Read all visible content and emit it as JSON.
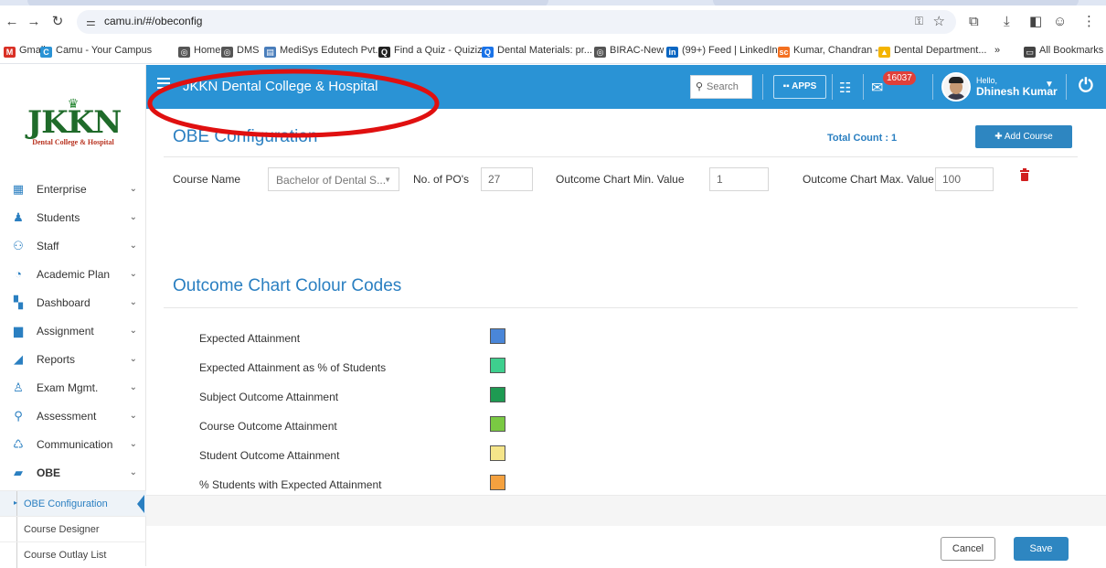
{
  "browser": {
    "url": "camu.in/#/obeconfig",
    "bookmarks": [
      {
        "label": "Gmail",
        "icon": "gmail-icon",
        "color": "#d93025"
      },
      {
        "label": "Camu - Your Campus",
        "icon": "camu-icon",
        "color": "#2a93d5"
      },
      {
        "label": "Home",
        "icon": "globe-icon",
        "color": "#555555"
      },
      {
        "label": "DMS",
        "icon": "globe-icon",
        "color": "#555555"
      },
      {
        "label": "MediSys Edutech Pvt...",
        "icon": "medisys-icon",
        "color": "#4a7ebb"
      },
      {
        "label": "Find a Quiz - Quizizz",
        "icon": "quizizz-icon",
        "color": "#222222"
      },
      {
        "label": "Dental Materials: pr...",
        "icon": "q-icon",
        "color": "#1a73e8"
      },
      {
        "label": "BIRAC-New",
        "icon": "globe-icon",
        "color": "#555555"
      },
      {
        "label": "(99+) Feed | LinkedIn",
        "icon": "linkedin-icon",
        "color": "#0a66c2"
      },
      {
        "label": "Kumar, Chandran -...",
        "icon": "sc-icon",
        "color": "#f37021"
      },
      {
        "label": "Dental Department...",
        "icon": "drive-icon",
        "color": "#f4b400"
      },
      {
        "label": "»",
        "icon": "",
        "color": ""
      },
      {
        "label": "All Bookmarks",
        "icon": "folder-icon",
        "color": "#444444"
      }
    ]
  },
  "sidebar": {
    "logo": {
      "name": "JKKN",
      "sub": "Dental College & Hospital"
    },
    "items": [
      {
        "label": "Enterprise",
        "icon": "building-icon",
        "color": "#2a7fc1"
      },
      {
        "label": "Students",
        "icon": "students-icon",
        "color": "#2a7fc1"
      },
      {
        "label": "Staff",
        "icon": "staff-icon",
        "color": "#2a7fc1"
      },
      {
        "label": "Academic Plan",
        "icon": "stopwatch-icon",
        "color": "#2a7fc1"
      },
      {
        "label": "Dashboard",
        "icon": "dashboard-icon",
        "color": "#2a7fc1"
      },
      {
        "label": "Assignment",
        "icon": "document-icon",
        "color": "#2a7fc1"
      },
      {
        "label": "Reports",
        "icon": "chart-icon",
        "color": "#2a7fc1"
      },
      {
        "label": "Exam Mgmt.",
        "icon": "exam-icon",
        "color": "#2a7fc1"
      },
      {
        "label": "Assessment",
        "icon": "search-icon",
        "color": "#2a7fc1"
      },
      {
        "label": "Communication",
        "icon": "communication-icon",
        "color": "#2a7fc1"
      },
      {
        "label": "OBE",
        "icon": "book-icon",
        "color": "#2a7fc1"
      }
    ],
    "subitems": [
      "OBE Configuration",
      "Course Designer",
      "Course Outlay List"
    ]
  },
  "topbar": {
    "title": "JKKN Dental College & Hospital",
    "search_placeholder": "Search",
    "apps_label": "APPS",
    "mail_count": "16037",
    "hello": "Hello,",
    "user_name": "Dhinesh Kumar"
  },
  "content": {
    "title": "OBE Configuration",
    "total_count": "Total Count : 1",
    "add_course": "Add Course",
    "course_name_label": "Course Name",
    "course_name_value": "Bachelor of Dental S...",
    "po_label": "No. of PO's",
    "po_value": "27",
    "min_label": "Outcome Chart Min. Value",
    "min_value": "1",
    "max_label": "Outcome Chart Max. Value",
    "max_value": "100",
    "colour_section_title": "Outcome Chart Colour Codes",
    "colour_codes": [
      {
        "label": "Expected Attainment",
        "color": "#4a86d8"
      },
      {
        "label": "Expected Attainment as % of Students",
        "color": "#3ecf8e"
      },
      {
        "label": "Subject Outcome Attainment",
        "color": "#1e9a52"
      },
      {
        "label": "Course Outcome Attainment",
        "color": "#7ac943"
      },
      {
        "label": "Student Outcome Attainment",
        "color": "#f5e58a"
      },
      {
        "label": "% Students with Expected Attainment",
        "color": "#f4a13f"
      }
    ]
  },
  "footer": {
    "cancel": "Cancel",
    "save": "Save"
  },
  "annotation": {
    "color": "#e01010"
  }
}
